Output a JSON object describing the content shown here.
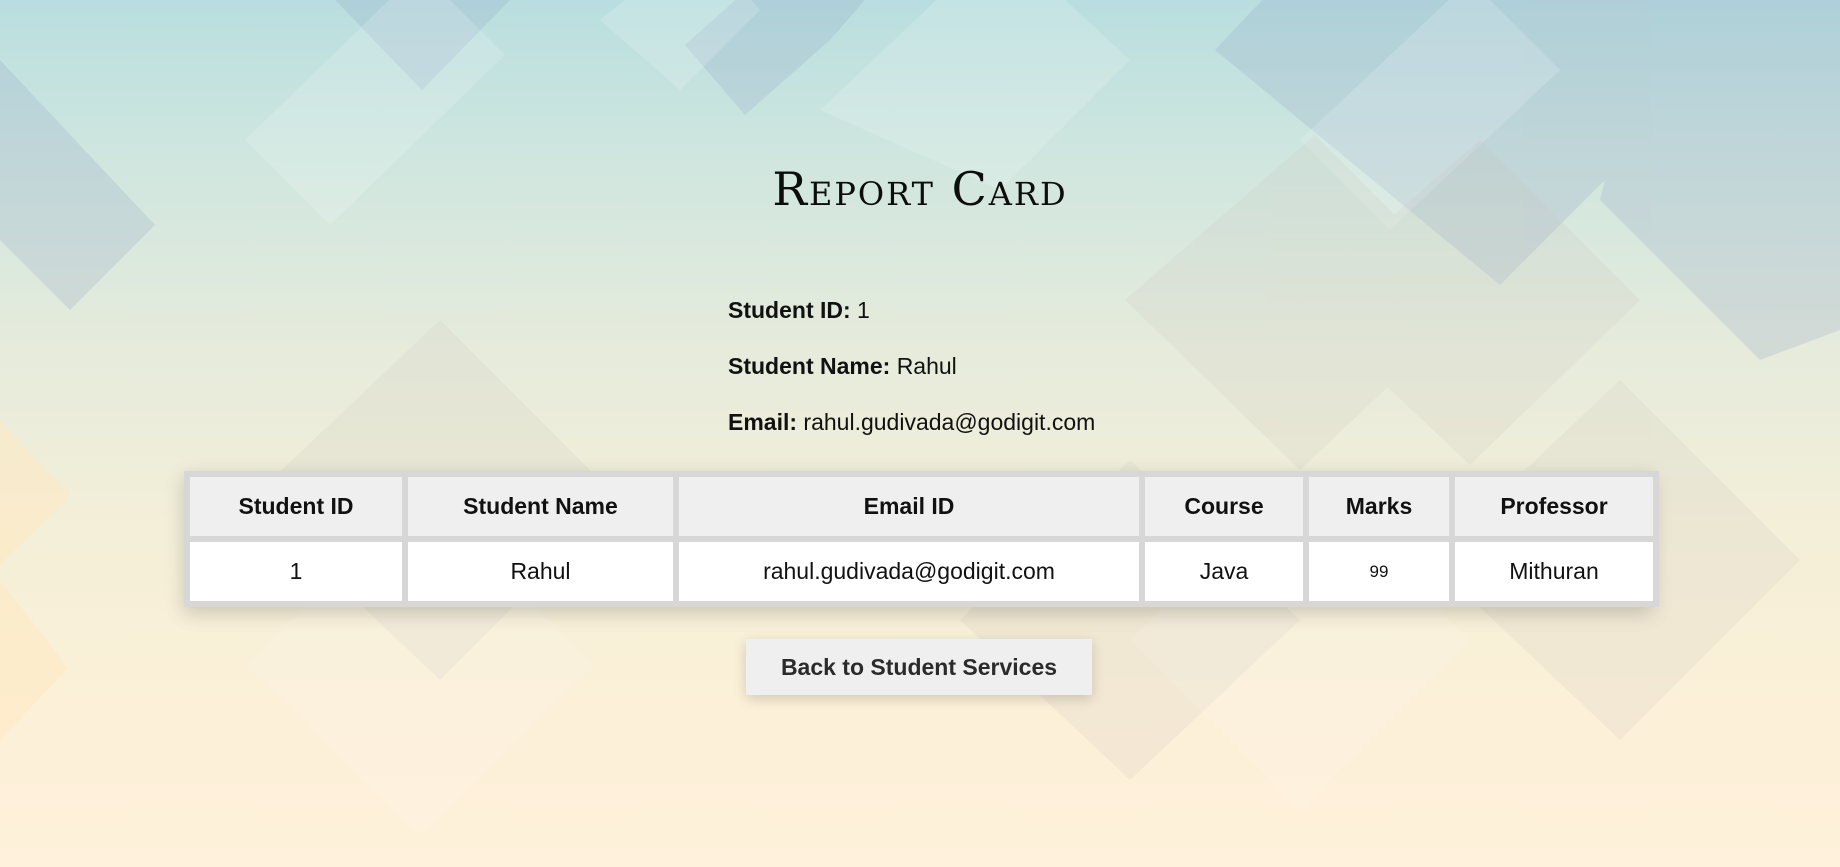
{
  "page": {
    "title": "Report Card"
  },
  "student_info": {
    "id_label": "Student ID:",
    "id_value": "1",
    "name_label": "Student Name:",
    "name_value": "Rahul",
    "email_label": "Email:",
    "email_value": "rahul.gudivada@godigit.com"
  },
  "table": {
    "headers": [
      "Student ID",
      "Student Name",
      "Email ID",
      "Course",
      "Marks",
      "Professor"
    ],
    "rows": [
      [
        "1",
        "Rahul",
        "rahul.gudivada@godigit.com",
        "Java",
        "99",
        "Mithuran"
      ]
    ]
  },
  "actions": {
    "back_label": "Back to Student Services"
  },
  "colors": {
    "header_cell_bg": "#efefef",
    "table_border": "#d7d7d7",
    "button_bg": "#efefef"
  }
}
